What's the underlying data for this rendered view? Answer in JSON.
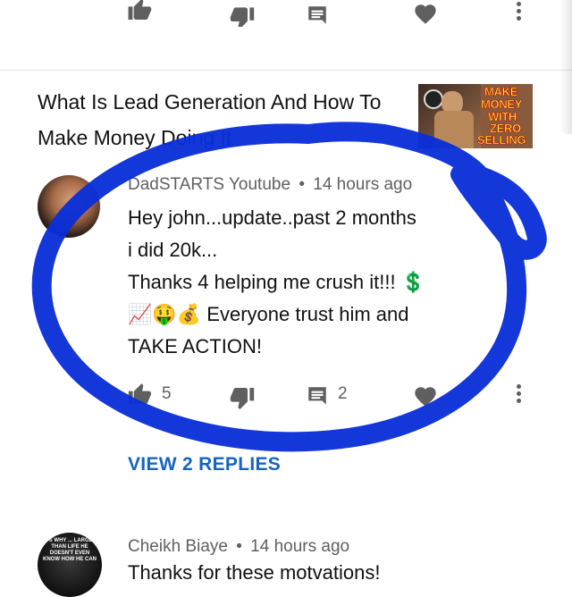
{
  "video": {
    "title": "What Is Lead Generation And How To Make Money Doing It",
    "thumbnail_words": [
      "MAKE",
      "MONEY",
      "WITH",
      "ZERO",
      "SELLING"
    ]
  },
  "comments": [
    {
      "author": "DadSTARTS Youtube",
      "time": "14 hours ago",
      "text_lines": [
        "Hey john...update..past 2 months",
        "i did 20k...",
        "Thanks 4 helping me crush it!!! 💲",
        "📈🤑💰 Everyone trust him and",
        "TAKE ACTION!"
      ],
      "likes": "5",
      "replies_count": "2",
      "view_replies": "VIEW 2 REPLIES"
    },
    {
      "author": "Cheikh Biaye",
      "time": "14 hours ago",
      "text_partial": "Thanks for these motvations!",
      "avatar_text": "IT'S WHY ... LARGER THAN LIFE HE DOESN'T EVEN KNOW HOW HE CAN"
    }
  ],
  "separator": "•",
  "colors": {
    "link": "#1565c0",
    "annotation": "#0a2fd8",
    "icon": "#5f5f5f"
  }
}
